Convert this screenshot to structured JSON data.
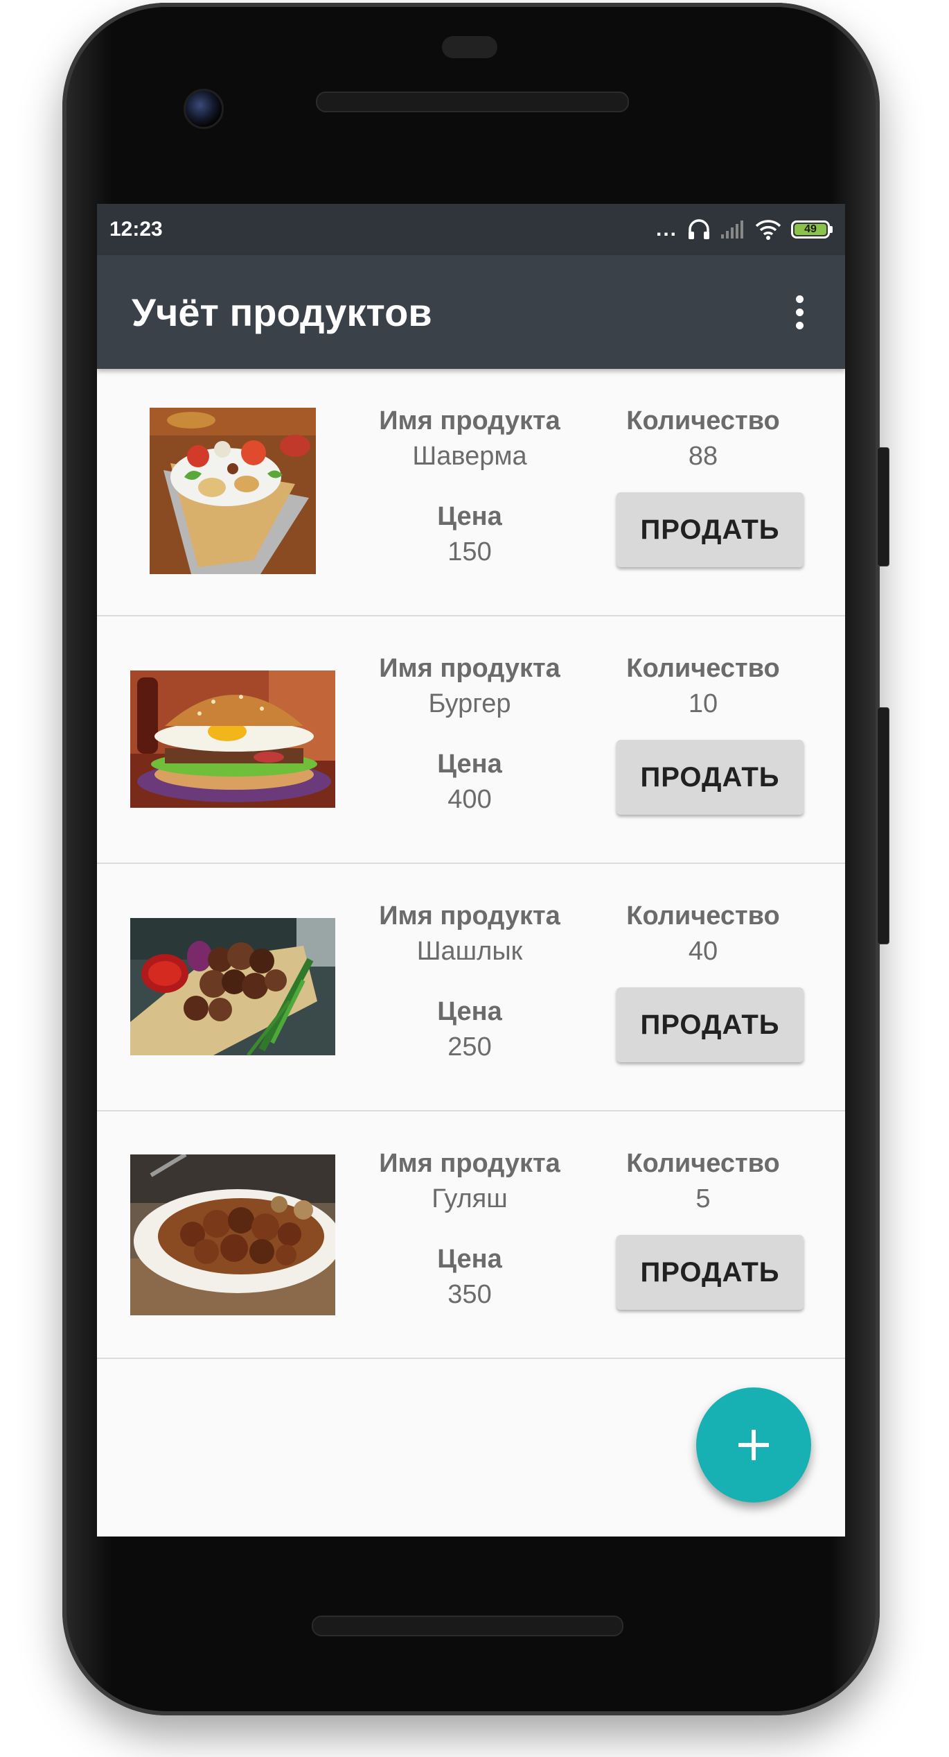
{
  "status_bar": {
    "time": "12:23",
    "dots": "...",
    "battery": "49",
    "icons": [
      "headset-icon",
      "signal-icon",
      "wifi-icon",
      "battery-icon"
    ]
  },
  "app_bar": {
    "title": "Учёт продуктов",
    "menu_icon": "overflow-menu-icon"
  },
  "products": [
    {
      "name_label": "Имя продукта",
      "name": "Шаверма",
      "price_label": "Цена",
      "price": "150",
      "qty_label": "Количество",
      "qty": "88",
      "sell_label": "ПРОДАТЬ",
      "image": "shawarma-photo"
    },
    {
      "name_label": "Имя продукта",
      "name": "Бургер",
      "price_label": "Цена",
      "price": "400",
      "qty_label": "Количество",
      "qty": "10",
      "sell_label": "ПРОДАТЬ",
      "image": "burger-photo"
    },
    {
      "name_label": "Имя продукта",
      "name": "Шашлык",
      "price_label": "Цена",
      "price": "250",
      "qty_label": "Количество",
      "qty": "40",
      "sell_label": "ПРОДАТЬ",
      "image": "shashlik-photo"
    },
    {
      "name_label": "Имя продукта",
      "name": "Гуляш",
      "price_label": "Цена",
      "price": "350",
      "qty_label": "Количество",
      "qty": "5",
      "sell_label": "ПРОДАТЬ",
      "image": "goulash-photo"
    }
  ],
  "fab": {
    "icon": "plus-icon",
    "color": "#17b0b3"
  },
  "colors": {
    "status_bar": "#2f353b",
    "app_bar": "#3b4148",
    "button": "#d9d9d9"
  }
}
